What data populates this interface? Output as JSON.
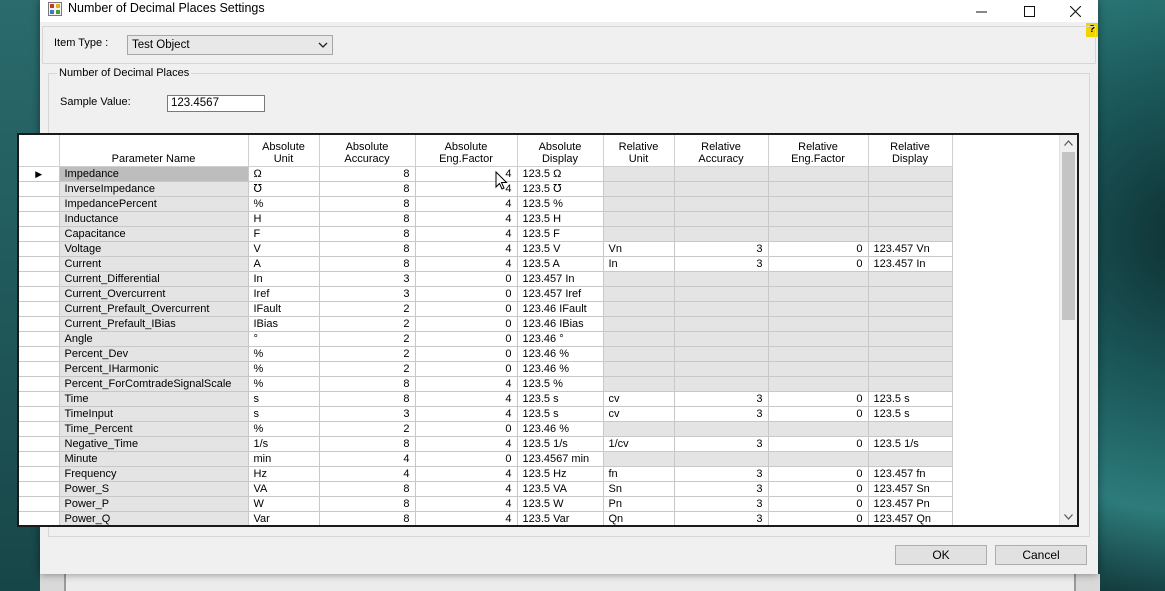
{
  "window": {
    "title": "Number of Decimal Places Settings"
  },
  "item_type": {
    "label": "Item Type :",
    "value": "Test Object"
  },
  "decimal_group": {
    "title": "Number of Decimal Places",
    "sample_label": "Sample Value:",
    "sample_value": "123.4567"
  },
  "help_label": "?",
  "columns": [
    "Parameter Name",
    "Absolute\nUnit",
    "Absolute\nAccuracy",
    "Absolute\nEng.Factor",
    "Absolute\nDisplay",
    "Relative\nUnit",
    "Relative\nAccuracy",
    "Relative\nEng.Factor",
    "Relative\nDisplay"
  ],
  "current_row_marker": "▶",
  "rows": [
    [
      "Impedance",
      "Ω",
      "8",
      "4",
      "123.5 Ω",
      "",
      "",
      "",
      ""
    ],
    [
      "InverseImpedance",
      "℧",
      "8",
      "4",
      "123.5 ℧",
      "",
      "",
      "",
      ""
    ],
    [
      "ImpedancePercent",
      "%",
      "8",
      "4",
      "123.5 %",
      "",
      "",
      "",
      ""
    ],
    [
      "Inductance",
      "H",
      "8",
      "4",
      "123.5 H",
      "",
      "",
      "",
      ""
    ],
    [
      "Capacitance",
      "F",
      "8",
      "4",
      "123.5 F",
      "",
      "",
      "",
      ""
    ],
    [
      "Voltage",
      "V",
      "8",
      "4",
      "123.5 V",
      "Vn",
      "3",
      "0",
      "123.457 Vn"
    ],
    [
      "Current",
      "A",
      "8",
      "4",
      "123.5 A",
      "In",
      "3",
      "0",
      "123.457 In"
    ],
    [
      "Current_Differential",
      "In",
      "3",
      "0",
      "123.457 In",
      "",
      "",
      "",
      ""
    ],
    [
      "Current_Overcurrent",
      "Iref",
      "3",
      "0",
      "123.457 Iref",
      "",
      "",
      "",
      ""
    ],
    [
      "Current_Prefault_Overcurrent",
      "IFault",
      "2",
      "0",
      "123.46 IFault",
      "",
      "",
      "",
      ""
    ],
    [
      "Current_Prefault_IBias",
      "IBias",
      "2",
      "0",
      "123.46 IBias",
      "",
      "",
      "",
      ""
    ],
    [
      "Angle",
      "°",
      "2",
      "0",
      "123.46 °",
      "",
      "",
      "",
      ""
    ],
    [
      "Percent_Dev",
      "%",
      "2",
      "0",
      "123.46 %",
      "",
      "",
      "",
      ""
    ],
    [
      "Percent_IHarmonic",
      "%",
      "2",
      "0",
      "123.46 %",
      "",
      "",
      "",
      ""
    ],
    [
      "Percent_ForComtradeSignalScale",
      "%",
      "8",
      "4",
      "123.5 %",
      "",
      "",
      "",
      ""
    ],
    [
      "Time",
      "s",
      "8",
      "4",
      "123.5 s",
      "cv",
      "3",
      "0",
      "123.5 s"
    ],
    [
      "TimeInput",
      "s",
      "3",
      "4",
      "123.5 s",
      "cv",
      "3",
      "0",
      "123.5 s"
    ],
    [
      "Time_Percent",
      "%",
      "2",
      "0",
      "123.46 %",
      "",
      "",
      "",
      ""
    ],
    [
      "Negative_Time",
      "1/s",
      "8",
      "4",
      "123.5 1/s",
      "1/cv",
      "3",
      "0",
      "123.5 1/s"
    ],
    [
      "Minute",
      "min",
      "4",
      "0",
      "123.4567 min",
      "",
      "",
      "",
      ""
    ],
    [
      "Frequency",
      "Hz",
      "4",
      "4",
      "123.5 Hz",
      "fn",
      "3",
      "0",
      "123.457 fn"
    ],
    [
      "Power_S",
      "VA",
      "8",
      "4",
      "123.5 VA",
      "Sn",
      "3",
      "0",
      "123.457 Sn"
    ],
    [
      "Power_P",
      "W",
      "8",
      "4",
      "123.5 W",
      "Pn",
      "3",
      "0",
      "123.457 Pn"
    ],
    [
      "Power_Q",
      "Var",
      "8",
      "4",
      "123.5 Var",
      "Qn",
      "3",
      "0",
      "123.457 Qn"
    ]
  ],
  "buttons": {
    "ok": "OK",
    "cancel": "Cancel"
  }
}
